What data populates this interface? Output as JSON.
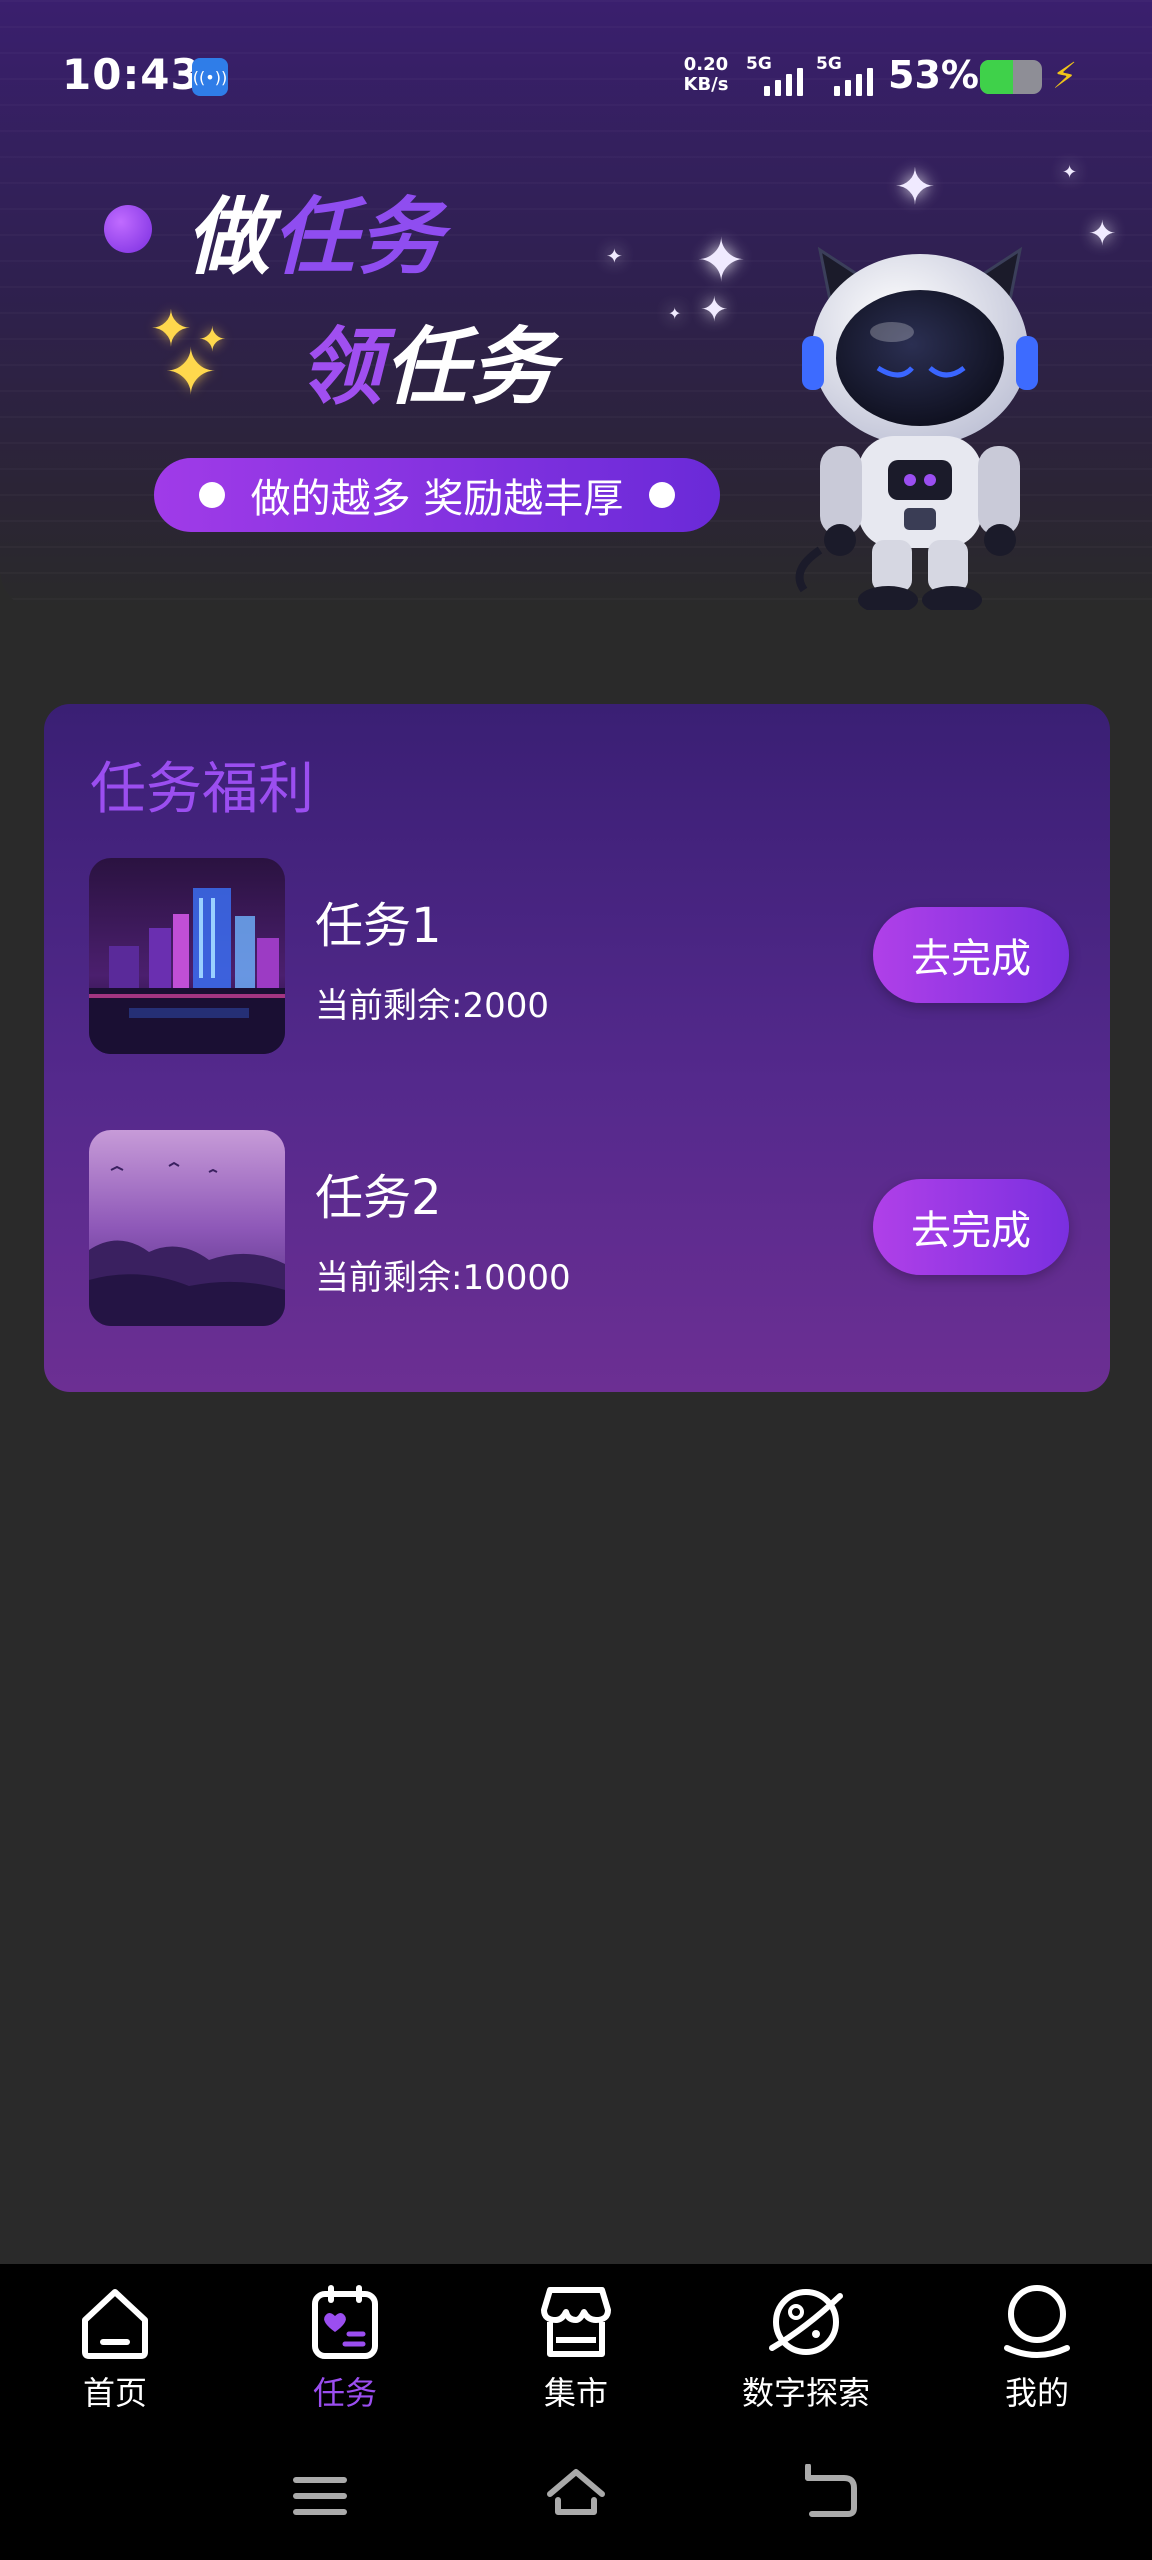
{
  "status_bar": {
    "time": "10:43",
    "speed_value": "0.20",
    "speed_unit": "KB/s",
    "sim1": "5G",
    "sim2": "5G",
    "battery_percent": "53%",
    "battery_level": 0.53
  },
  "hero": {
    "line1_a": "做",
    "line1_b": "任务",
    "line2_a": "领",
    "line2_b": "任务",
    "pill_text": "做的越多  奖励越丰厚"
  },
  "tasks_card": {
    "title": "任务福利",
    "items": [
      {
        "name": "任务1",
        "remaining": "当前剩余:2000",
        "button": "去完成"
      },
      {
        "name": "任务2",
        "remaining": "当前剩余:10000",
        "button": "去完成"
      }
    ]
  },
  "bottom_nav": {
    "items": [
      {
        "label": "首页",
        "icon": "home-icon"
      },
      {
        "label": "任务",
        "icon": "task-calendar-icon",
        "active": true
      },
      {
        "label": "集市",
        "icon": "market-store-icon"
      },
      {
        "label": "数字探索",
        "icon": "planet-explore-icon"
      },
      {
        "label": "我的",
        "icon": "profile-icon"
      }
    ]
  },
  "colors": {
    "accent": "#9b4ef0",
    "background": "#2a2a2a",
    "nav_background": "#000000"
  }
}
